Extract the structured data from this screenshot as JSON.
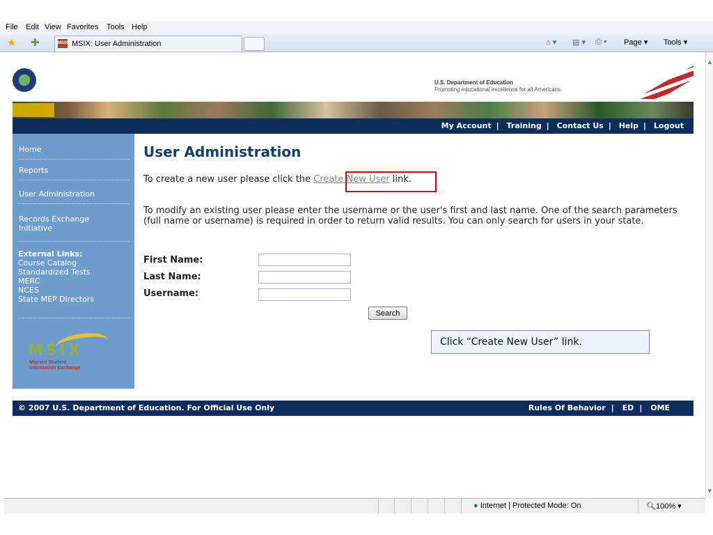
{
  "browser": {
    "menu": [
      "File",
      "Edit",
      "View",
      "Favorites",
      "Tools",
      "Help"
    ],
    "menu_access": [
      "F",
      "E",
      "V",
      "a",
      "T",
      "H"
    ],
    "tab_title": "MSIX: User Administration",
    "commands": {
      "home": "⌂ ▾",
      "feeds": "▤ ▾",
      "print": "⎙ ▾",
      "page": "Page ▾",
      "tools": "Tools ▾"
    },
    "zone": "Internet | Protected Mode: On",
    "zoom": "100%"
  },
  "header": {
    "dept": "U.S. Department of Education",
    "tagline": "Promoting educational excellence for all Americans"
  },
  "nav": {
    "links": [
      "My Account",
      "Training",
      "Contact Us",
      "Help",
      "Logout"
    ]
  },
  "sidebar": {
    "items": [
      "Home",
      "Reports",
      "User Administration",
      "Records Exchange Initiative"
    ],
    "external_heading": "External Links:",
    "external_links": [
      "Course Catalog",
      "Standardized Tests",
      "MERC",
      "NCES",
      "State MEP Directors"
    ],
    "logo_text": "MSIX",
    "logo_sub1": "Migrant Student",
    "logo_sub2": "Information Exchange"
  },
  "main": {
    "title": "User Administration",
    "create_pre": "To create a new user please click the ",
    "create_link": "Create New User",
    "create_post": " link.",
    "modify_text": "To modify an existing user please enter the username or the user's first and last name. One of the search parameters (full name or username) is required in order to return valid results. You can only search for users in your state.",
    "fields": {
      "first_name_label": "First Name:",
      "last_name_label": "Last Name:",
      "username_label": "Username:",
      "first_name_value": "",
      "last_name_value": "",
      "username_value": ""
    },
    "search_button": "Search",
    "callout": "Click “Create New User” link."
  },
  "footer": {
    "copyright": "© 2007 U.S. Department of Education. For Official Use Only",
    "links": [
      "Rules Of Behavior",
      "ED",
      "OME"
    ]
  }
}
